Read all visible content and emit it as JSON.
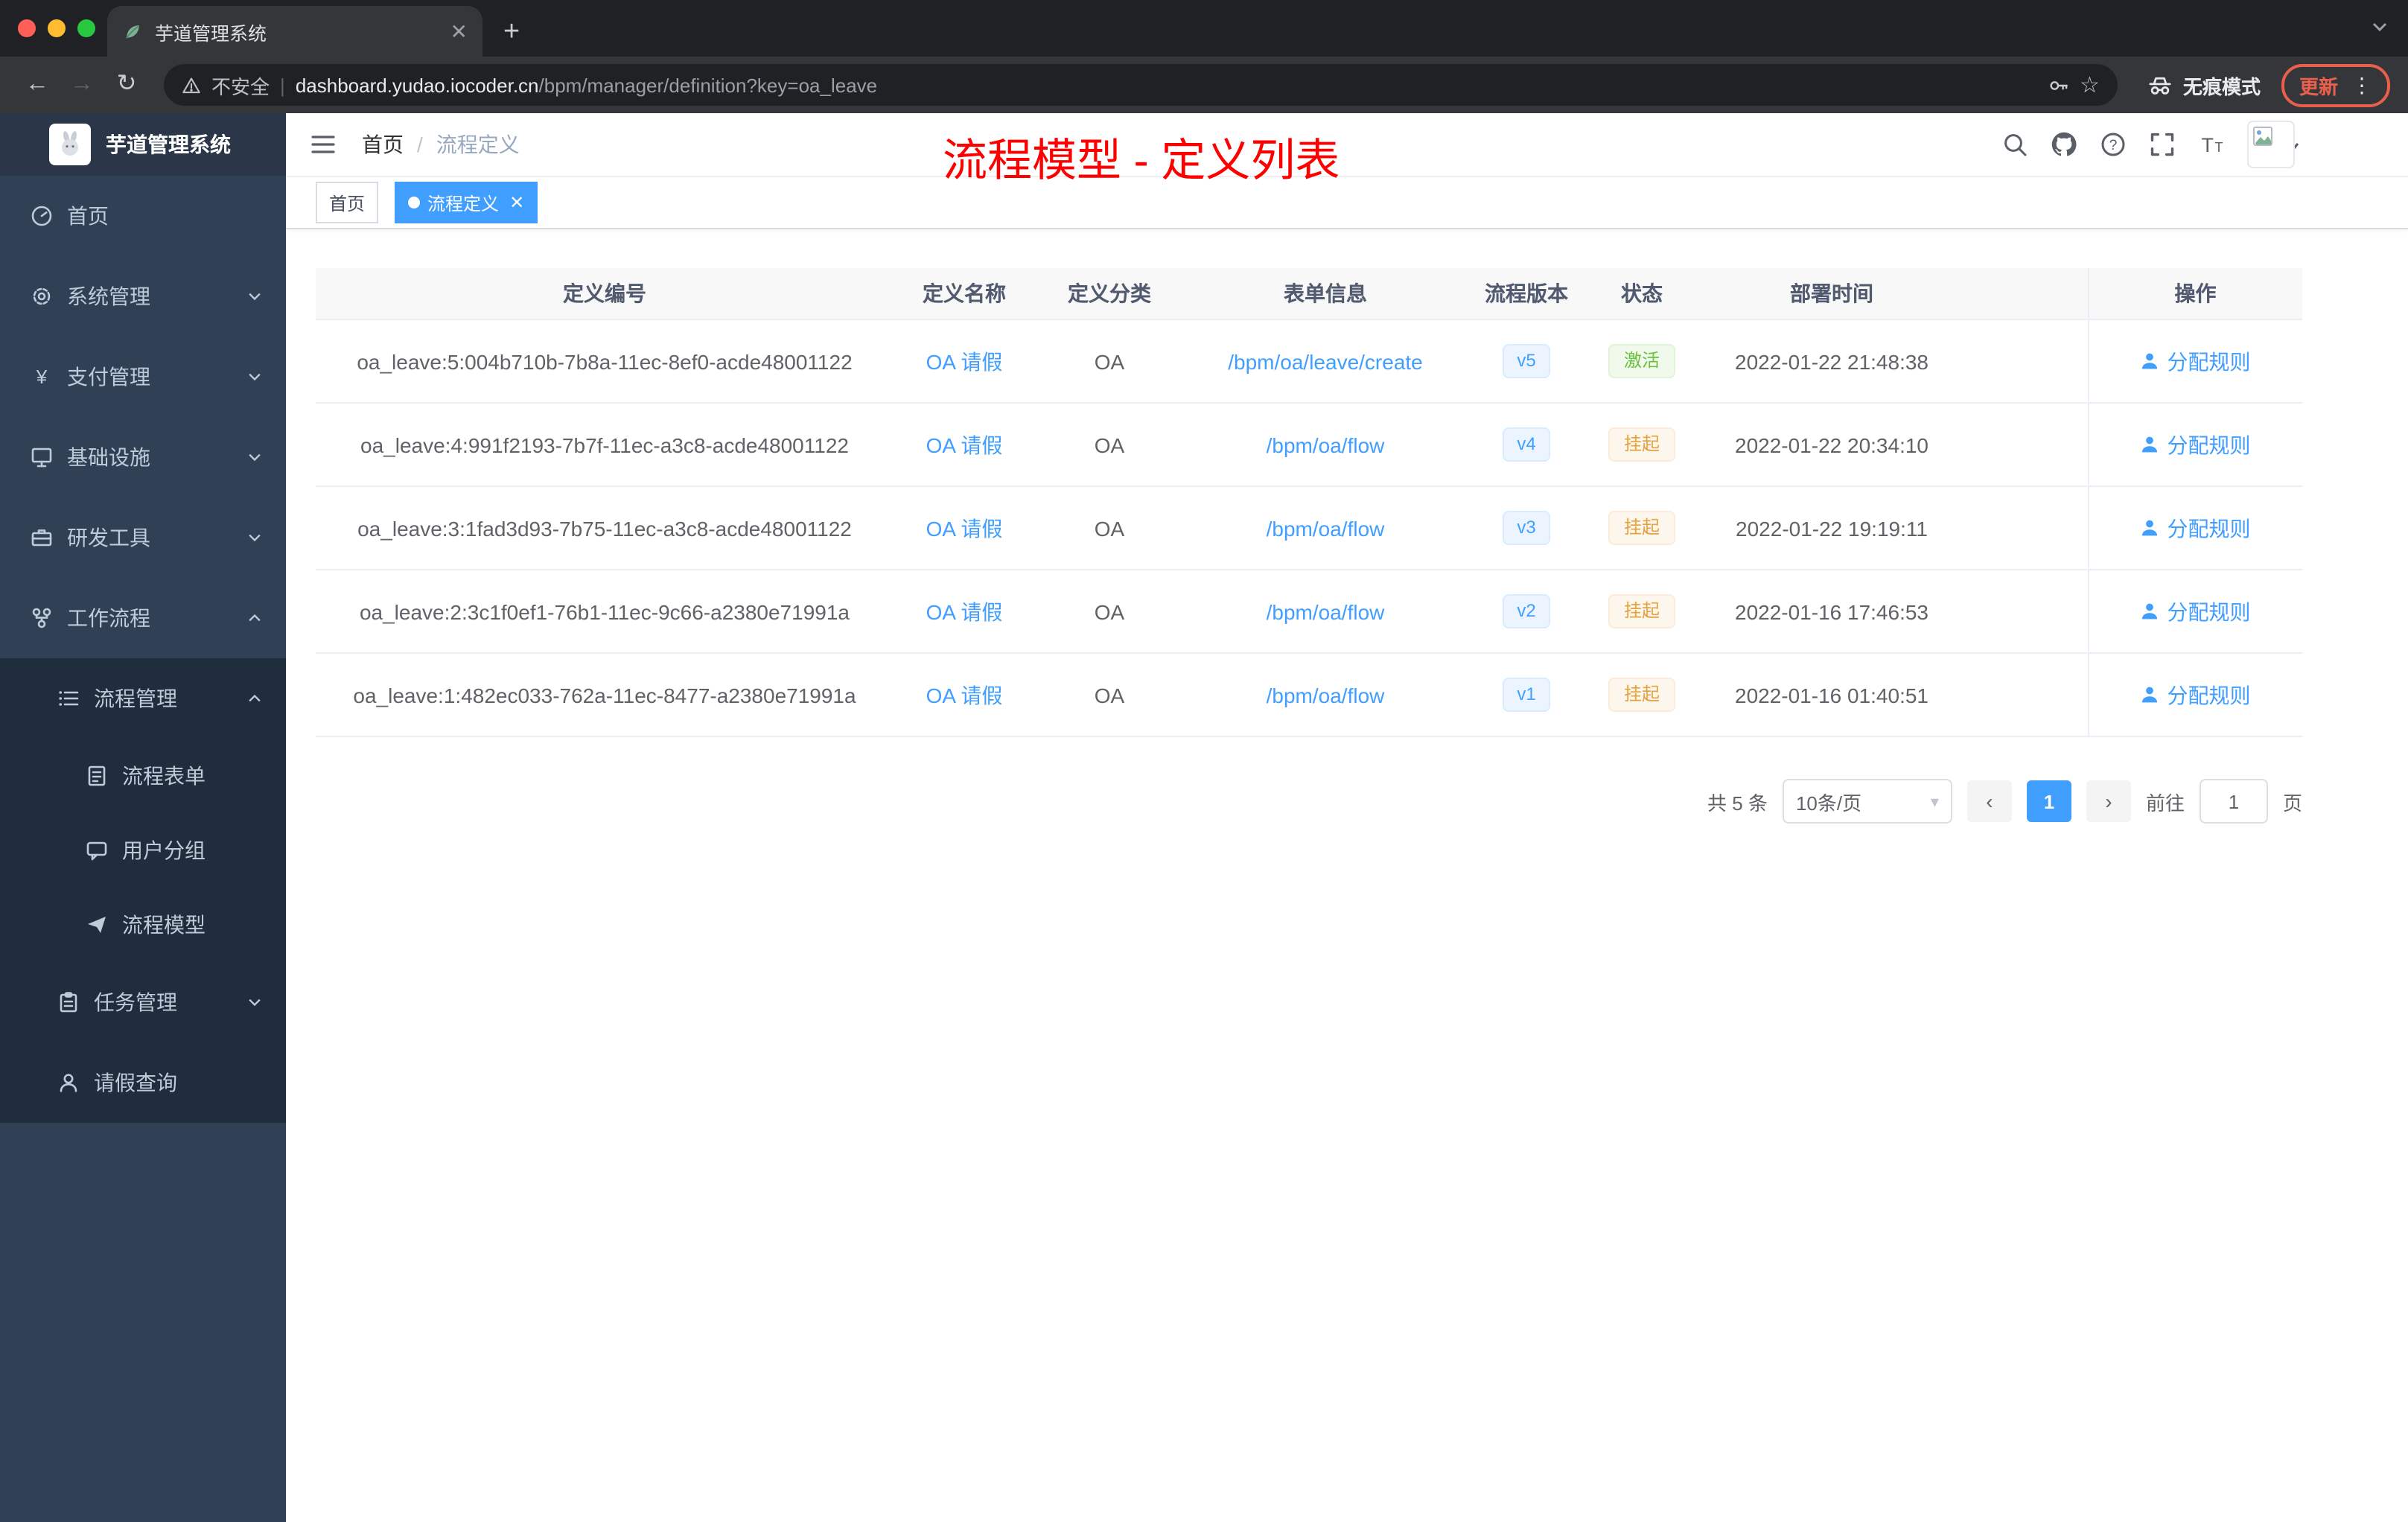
{
  "colors": {
    "primary": "#409eff",
    "success": "#67c23a",
    "warning": "#e6a23c",
    "annotation_red": "#ff0000",
    "sidebar_bg": "#304156",
    "submenu_bg": "#1f2d3d"
  },
  "browser": {
    "tab_title": "芋道管理系统",
    "security_label": "不安全",
    "url_domain": "dashboard.yudao.iocoder.cn",
    "url_path": "/bpm/manager/definition?key=oa_leave",
    "incognito_label": "无痕模式",
    "update_label": "更新"
  },
  "sidebar": {
    "brand": "芋道管理系统",
    "items": [
      {
        "label": "首页"
      },
      {
        "label": "系统管理"
      },
      {
        "label": "支付管理"
      },
      {
        "label": "基础设施"
      },
      {
        "label": "研发工具"
      },
      {
        "label": "工作流程"
      },
      {
        "label": "流程管理"
      },
      {
        "label": "流程表单"
      },
      {
        "label": "用户分组"
      },
      {
        "label": "流程模型"
      },
      {
        "label": "任务管理"
      },
      {
        "label": "请假查询"
      }
    ]
  },
  "header": {
    "breadcrumb_home": "首页",
    "breadcrumb_current": "流程定义",
    "annotation": "流程模型 - 定义列表"
  },
  "tags": {
    "home": "首页",
    "active": "流程定义"
  },
  "table": {
    "columns": {
      "id": "定义编号",
      "name": "定义名称",
      "category": "定义分类",
      "form": "表单信息",
      "version": "流程版本",
      "status": "状态",
      "deploy_time": "部署时间",
      "action": "操作"
    },
    "rows": [
      {
        "id": "oa_leave:5:004b710b-7b8a-11ec-8ef0-acde48001122",
        "name": "OA 请假",
        "category": "OA",
        "form": "/bpm/oa/leave/create",
        "version": "v5",
        "status": "激活",
        "deploy_time": "2022-01-22 21:48:38",
        "action": "分配规则"
      },
      {
        "id": "oa_leave:4:991f2193-7b7f-11ec-a3c8-acde48001122",
        "name": "OA 请假",
        "category": "OA",
        "form": "/bpm/oa/flow",
        "version": "v4",
        "status": "挂起",
        "deploy_time": "2022-01-22 20:34:10",
        "action": "分配规则"
      },
      {
        "id": "oa_leave:3:1fad3d93-7b75-11ec-a3c8-acde48001122",
        "name": "OA 请假",
        "category": "OA",
        "form": "/bpm/oa/flow",
        "version": "v3",
        "status": "挂起",
        "deploy_time": "2022-01-22 19:19:11",
        "action": "分配规则"
      },
      {
        "id": "oa_leave:2:3c1f0ef1-76b1-11ec-9c66-a2380e71991a",
        "name": "OA 请假",
        "category": "OA",
        "form": "/bpm/oa/flow",
        "version": "v2",
        "status": "挂起",
        "deploy_time": "2022-01-16 17:46:53",
        "action": "分配规则"
      },
      {
        "id": "oa_leave:1:482ec033-762a-11ec-8477-a2380e71991a",
        "name": "OA 请假",
        "category": "OA",
        "form": "/bpm/oa/flow",
        "version": "v1",
        "status": "挂起",
        "deploy_time": "2022-01-16 01:40:51",
        "action": "分配规则"
      }
    ]
  },
  "pagination": {
    "total": "共 5 条",
    "page_size": "10条/页",
    "current_page": "1",
    "goto_label": "前往",
    "goto_value": "1",
    "page_unit": "页"
  }
}
